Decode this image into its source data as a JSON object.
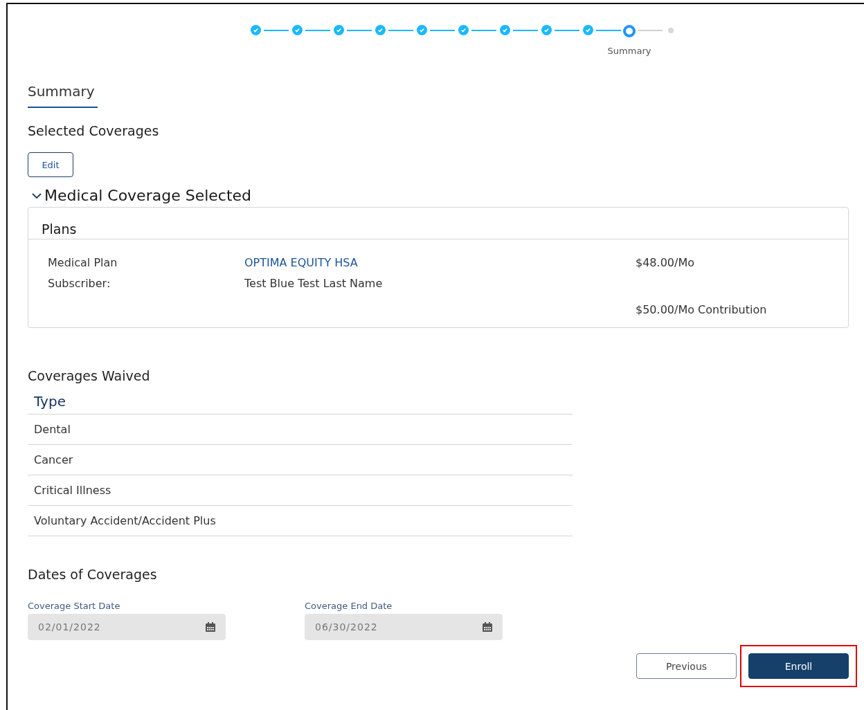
{
  "progress": {
    "steps": [
      {
        "completed": true,
        "selected": false
      },
      {
        "completed": true,
        "selected": false
      },
      {
        "completed": true,
        "selected": false
      },
      {
        "completed": true,
        "selected": false
      },
      {
        "completed": true,
        "selected": false
      },
      {
        "completed": true,
        "selected": false
      },
      {
        "completed": true,
        "selected": false
      },
      {
        "completed": true,
        "selected": false
      },
      {
        "completed": true,
        "selected": false
      },
      {
        "completed": false,
        "selected": true,
        "label": "Summary"
      },
      {
        "completed": false,
        "selected": false
      }
    ]
  },
  "page_title": "Summary",
  "selected_coverages": {
    "heading": "Selected Coverages",
    "edit_button": "Edit"
  },
  "medical_section": {
    "title": "Medical Coverage Selected",
    "expanded": true,
    "card_title": "Plans",
    "rows": [
      {
        "label": "Medical Plan",
        "value": "OPTIMA EQUITY HSA",
        "kind": "link",
        "amount": "$48.00/Mo"
      },
      {
        "label": "Subscriber:",
        "value": "Test Blue Test Last Name",
        "kind": "text"
      }
    ],
    "contribution": "$50.00/Mo Contribution"
  },
  "coverages_waived": {
    "heading": "Coverages Waived",
    "column": "Type",
    "rows": [
      "Dental",
      "Cancer",
      "Critical Illness",
      "Voluntary Accident/Accident Plus"
    ]
  },
  "dates": {
    "heading": "Dates of Coverages",
    "fields": [
      {
        "label": "Coverage Start Date",
        "value": "02/01/2022",
        "disabled": true
      },
      {
        "label": "Coverage End Date",
        "value": "06/30/2022",
        "disabled": true
      }
    ]
  },
  "buttons": [
    {
      "label": "Previous",
      "kind": "secondary",
      "highlighted": false
    },
    {
      "label": "Enroll",
      "kind": "primary",
      "highlighted": true
    }
  ]
}
